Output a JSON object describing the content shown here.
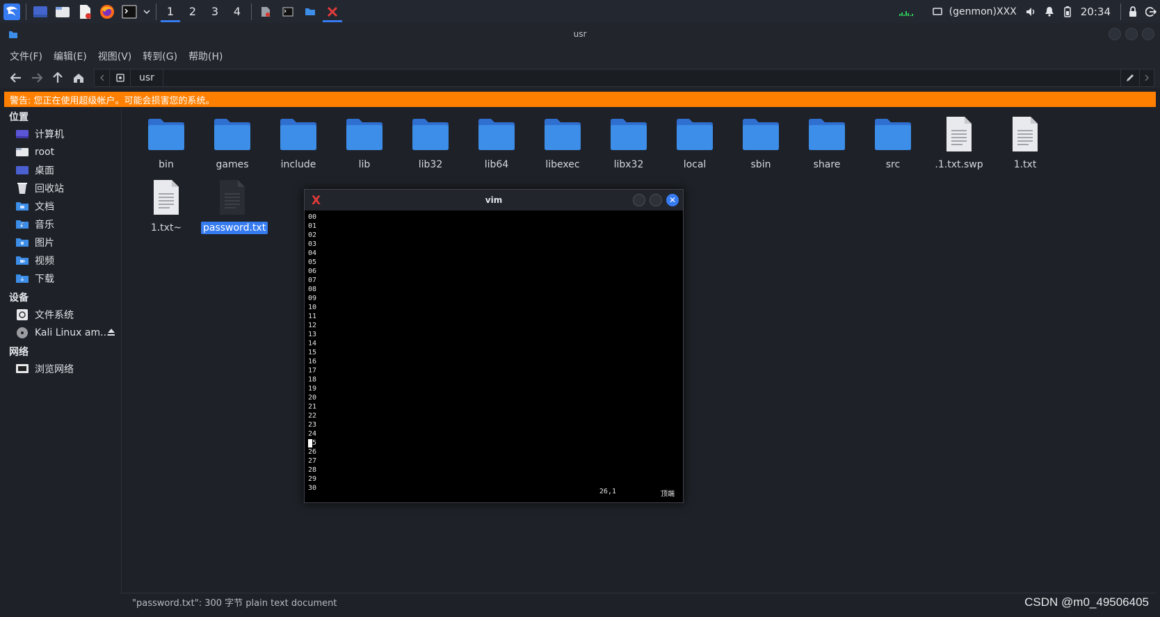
{
  "panel": {
    "workspaces": [
      "1",
      "2",
      "3",
      "4"
    ],
    "active_workspace": "1",
    "genmon": "(genmon)XXX",
    "clock": "20:34"
  },
  "window": {
    "title": "usr"
  },
  "menu": [
    "文件(F)",
    "编辑(E)",
    "视图(V)",
    "转到(G)",
    "帮助(H)"
  ],
  "path": {
    "crumb": "usr"
  },
  "warning": "警告: 您正在使用超级帐户。可能会损害您的系统。",
  "sidebar": {
    "places_header": "位置",
    "places": [
      {
        "label": "计算机",
        "icon": "computer-icon"
      },
      {
        "label": "root",
        "icon": "home-folder-icon"
      },
      {
        "label": "桌面",
        "icon": "desktop-icon"
      },
      {
        "label": "回收站",
        "icon": "trash-icon"
      },
      {
        "label": "文档",
        "icon": "documents-folder-icon"
      },
      {
        "label": "音乐",
        "icon": "music-folder-icon"
      },
      {
        "label": "图片",
        "icon": "pictures-folder-icon"
      },
      {
        "label": "视频",
        "icon": "videos-folder-icon"
      },
      {
        "label": "下载",
        "icon": "downloads-folder-icon"
      }
    ],
    "devices_header": "设备",
    "devices": [
      {
        "label": "文件系统",
        "icon": "drive-icon"
      },
      {
        "label": "Kali Linux am...",
        "icon": "disc-icon"
      }
    ],
    "network_header": "网络",
    "network": [
      {
        "label": "浏览网络",
        "icon": "network-icon"
      }
    ]
  },
  "files": [
    {
      "name": "bin",
      "type": "folder"
    },
    {
      "name": "games",
      "type": "folder"
    },
    {
      "name": "include",
      "type": "folder"
    },
    {
      "name": "lib",
      "type": "folder"
    },
    {
      "name": "lib32",
      "type": "folder"
    },
    {
      "name": "lib64",
      "type": "folder"
    },
    {
      "name": "libexec",
      "type": "folder"
    },
    {
      "name": "libx32",
      "type": "folder"
    },
    {
      "name": "local",
      "type": "folder"
    },
    {
      "name": "sbin",
      "type": "folder"
    },
    {
      "name": "share",
      "type": "folder"
    },
    {
      "name": "src",
      "type": "folder"
    },
    {
      "name": ".1.txt.swp",
      "type": "text"
    },
    {
      "name": "1.txt",
      "type": "text"
    },
    {
      "name": "1.txt~",
      "type": "text"
    },
    {
      "name": "password.txt",
      "type": "text-dark",
      "selected": true
    }
  ],
  "status": "\"password.txt\": 300 字节 plain text document",
  "watermark": "CSDN @m0_49506405",
  "vim": {
    "title": "vim",
    "lines": [
      "00",
      "01",
      "02",
      "03",
      "04",
      "05",
      "06",
      "07",
      "08",
      "09",
      "10",
      "11",
      "12",
      "13",
      "14",
      "15",
      "16",
      "17",
      "18",
      "19",
      "20",
      "21",
      "22",
      "23",
      "24",
      "25",
      "26",
      "27",
      "28",
      "29",
      "30"
    ],
    "position": "26,1",
    "scroll": "顶端"
  },
  "colors": {
    "accent": "#367bf0",
    "warning": "#ff7f00",
    "folder": "#3d8ee8"
  }
}
